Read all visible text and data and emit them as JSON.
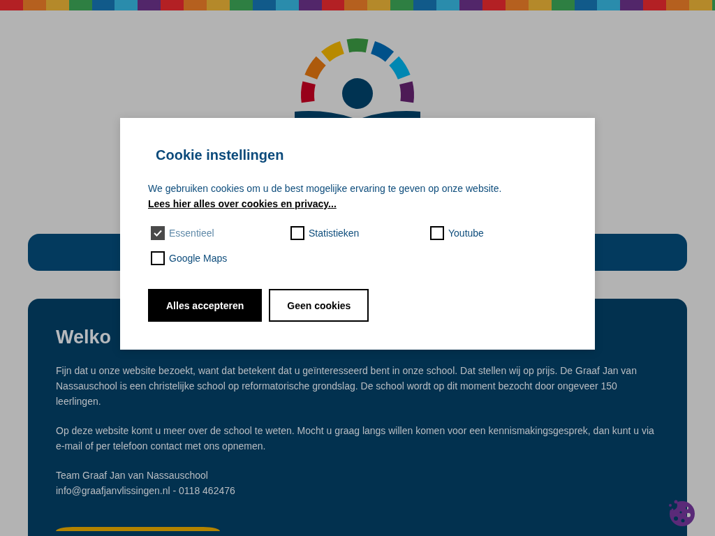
{
  "cookie_dialog": {
    "title": "Cookie instellingen",
    "description": "We gebruiken cookies om u de best mogelijke ervaring te geven op onze website.",
    "link": "Lees hier alles over cookies en privacy...",
    "options": [
      {
        "label": "Essentieel",
        "checked": true,
        "disabled": true
      },
      {
        "label": "Statistieken",
        "checked": false,
        "disabled": false
      },
      {
        "label": "Youtube",
        "checked": false,
        "disabled": false
      },
      {
        "label": "Google Maps",
        "checked": false,
        "disabled": false
      }
    ],
    "buttons": [
      {
        "label": "Alles accepteren",
        "kind": "primary"
      },
      {
        "label": "Geen cookies",
        "kind": "secondary"
      }
    ]
  },
  "welcome": {
    "heading": "Welko",
    "paragraphs": [
      "Fijn dat u onze website bezoekt, want dat betekent dat u geïnteresseerd bent in onze school. Dat stellen wij op prijs. De Graaf Jan van Nassauschool is een christelijke school op reformatorische grondslag. De school wordt op dit moment bezocht door ongeveer 150 leerlingen.",
      "Op deze website komt u meer over de school te weten. Mocht u graag langs willen komen voor een kennismakingsgesprek, dan kunt u via e-mail of per telefoon contact met ons opnemen."
    ],
    "signature": [
      "Team Graaf Jan van Nassauschool",
      "info@graafjanvlissingen.nl - 0118 462476"
    ]
  }
}
